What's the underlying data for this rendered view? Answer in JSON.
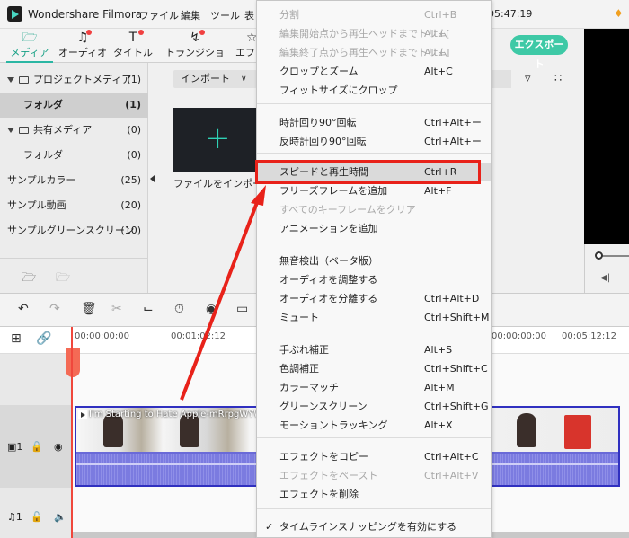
{
  "app": {
    "name": "Wondershare Filmora",
    "clock": "05:47:19"
  },
  "menubar": [
    "ファイル",
    "編集",
    "ツール",
    "表"
  ],
  "tabs": [
    {
      "label": "メディア",
      "icon": "folder-icon"
    },
    {
      "label": "オーディオ",
      "icon": "music-note-icon"
    },
    {
      "label": "タイトル",
      "icon": "text-icon"
    },
    {
      "label": "トランジション",
      "icon": "transition-icon"
    },
    {
      "label": "エフェ",
      "icon": "effects-icon"
    }
  ],
  "export_label": "エクスポート",
  "left_panel": {
    "items": [
      {
        "label": "プロジェクトメディア",
        "count": "(1)"
      },
      {
        "label": "フォルダ",
        "count": "(1)"
      },
      {
        "label": "共有メディア",
        "count": "(0)"
      },
      {
        "label": "フォルダ",
        "count": "(0)"
      },
      {
        "label": "サンプルカラー",
        "count": "(25)"
      },
      {
        "label": "サンプル動画",
        "count": "(20)"
      },
      {
        "label": "サンプルグリーンスクリーン",
        "count": "(10)"
      }
    ]
  },
  "media": {
    "import_dropdown": "インポート",
    "import_tile_label": "ファイルをインポート"
  },
  "ruler": [
    "00:00:00:00",
    "00:01:02:12",
    "00:05:12:12"
  ],
  "clip": {
    "title": "I'm Starting to Hate Apple-mRrpgWYWZg"
  },
  "tracks": {
    "video_num": "1",
    "audio_num": "1"
  },
  "context_menu": {
    "groups": [
      [
        {
          "label": "分割",
          "shortcut": "Ctrl+B",
          "disabled": true
        },
        {
          "label": "編集開始点から再生ヘッドまでトリム",
          "shortcut": "Alt+[",
          "disabled": true
        },
        {
          "label": "編集終了点から再生ヘッドまでトリム",
          "shortcut": "Alt+]",
          "disabled": true
        },
        {
          "label": "クロップとズーム",
          "shortcut": "Alt+C",
          "disabled": false
        },
        {
          "label": "フィットサイズにクロップ",
          "shortcut": "",
          "disabled": false
        }
      ],
      [
        {
          "label": "時計回り90°回転",
          "shortcut": "Ctrl+Alt+ー",
          "disabled": false
        },
        {
          "label": "反時計回り90°回転",
          "shortcut": "Ctrl+Alt+ー",
          "disabled": false
        }
      ],
      [
        {
          "label": "スピードと再生時間",
          "shortcut": "Ctrl+R",
          "disabled": false,
          "highlighted": true
        },
        {
          "label": "フリーズフレームを追加",
          "shortcut": "Alt+F",
          "disabled": false
        },
        {
          "label": "すべてのキーフレームをクリア",
          "shortcut": "",
          "disabled": true
        },
        {
          "label": "アニメーションを追加",
          "shortcut": "",
          "disabled": false
        }
      ],
      [
        {
          "label": "無音検出（ベータ版）",
          "shortcut": "",
          "disabled": false
        },
        {
          "label": "オーディオを調整する",
          "shortcut": "",
          "disabled": false
        },
        {
          "label": "オーディオを分離する",
          "shortcut": "Ctrl+Alt+D",
          "disabled": false
        },
        {
          "label": "ミュート",
          "shortcut": "Ctrl+Shift+M",
          "disabled": false
        }
      ],
      [
        {
          "label": "手ぶれ補正",
          "shortcut": "Alt+S",
          "disabled": false
        },
        {
          "label": "色調補正",
          "shortcut": "Ctrl+Shift+C",
          "disabled": false
        },
        {
          "label": "カラーマッチ",
          "shortcut": "Alt+M",
          "disabled": false
        },
        {
          "label": "グリーンスクリーン",
          "shortcut": "Ctrl+Shift+G",
          "disabled": false
        },
        {
          "label": "モーショントラッキング",
          "shortcut": "Alt+X",
          "disabled": false
        }
      ],
      [
        {
          "label": "エフェクトをコピー",
          "shortcut": "Ctrl+Alt+C",
          "disabled": false
        },
        {
          "label": "エフェクトをペースト",
          "shortcut": "Ctrl+Alt+V",
          "disabled": true
        },
        {
          "label": "エフェクトを削除",
          "shortcut": "",
          "disabled": false
        }
      ],
      [
        {
          "label": "タイムラインスナッピングを有効にする",
          "shortcut": "",
          "disabled": false,
          "checked": true
        }
      ]
    ]
  },
  "colors": {
    "accent": "#2ab6a3",
    "highlight_box": "#e8221a",
    "clip": "#6a6ad8",
    "playhead": "#f0473c"
  }
}
